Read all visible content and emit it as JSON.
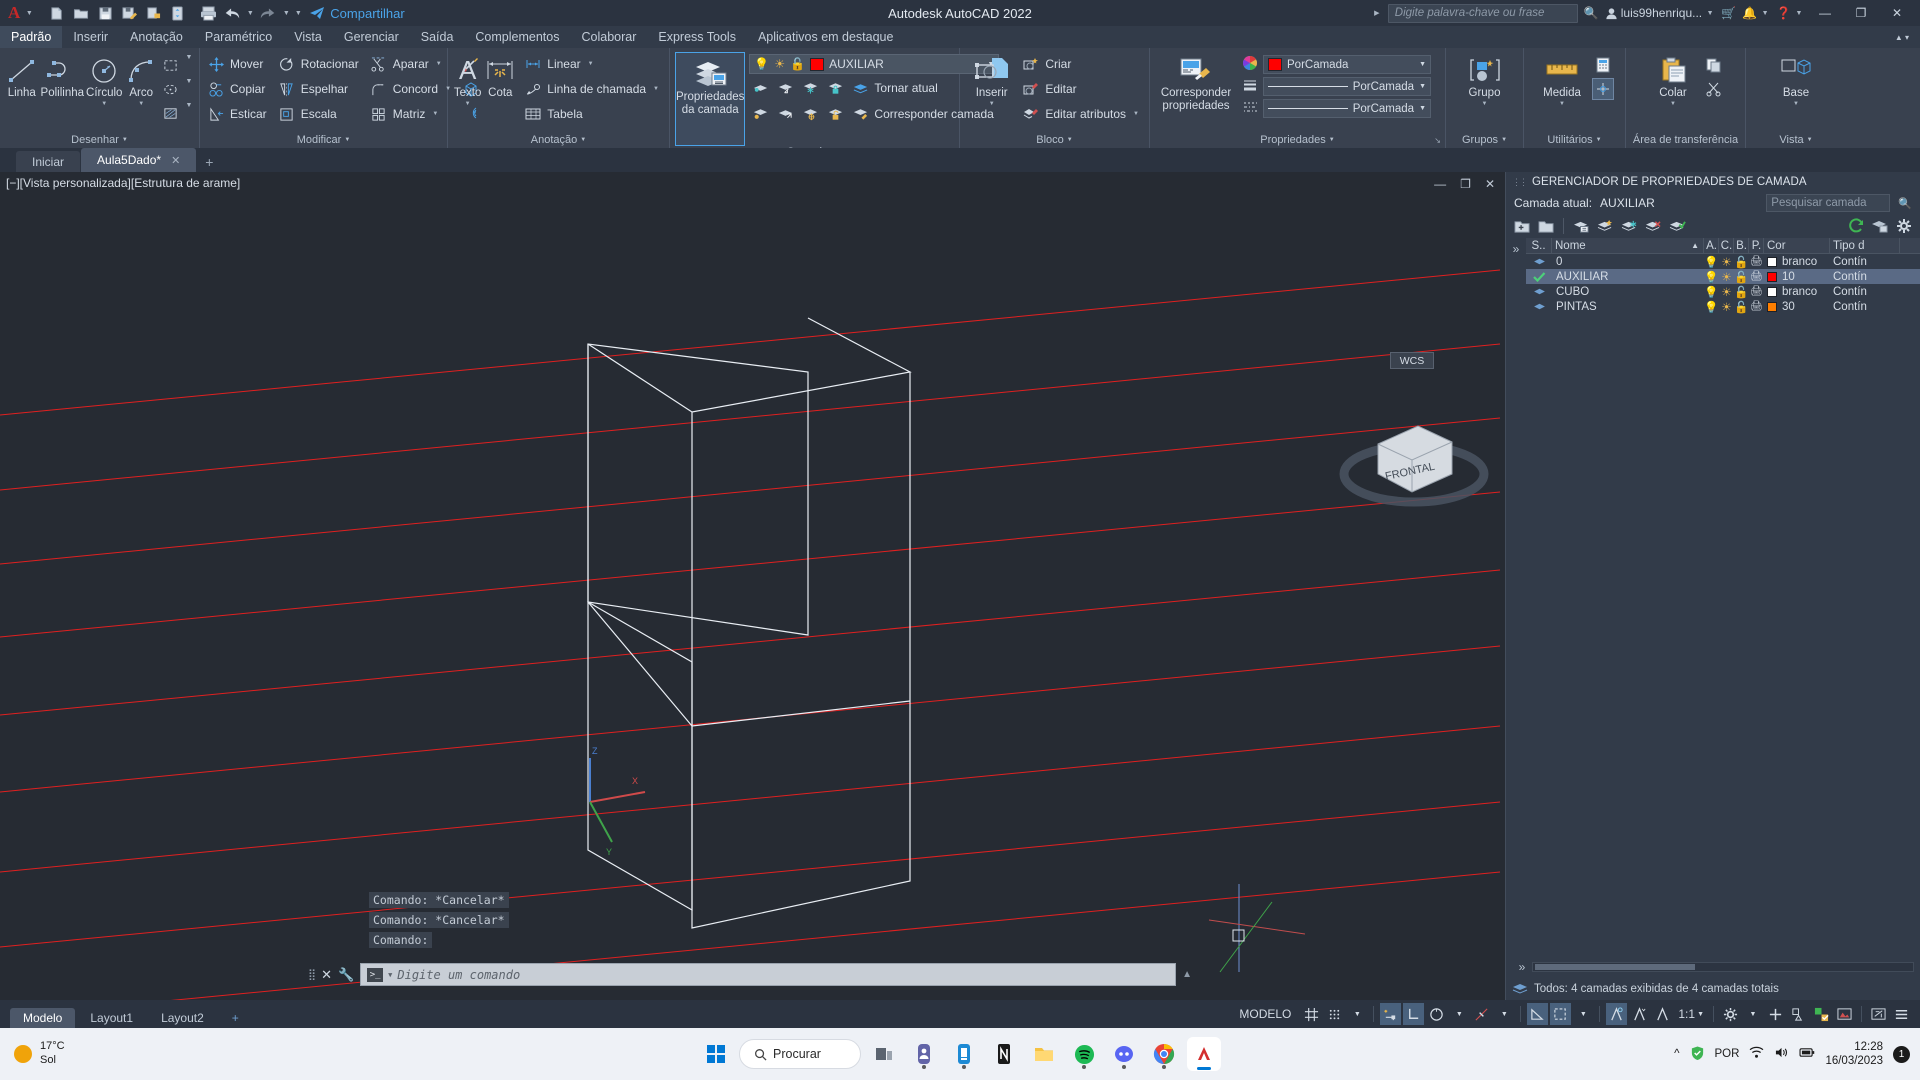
{
  "window": {
    "title": "Autodesk AutoCAD 2022",
    "share_label": "Compartilhar",
    "search_placeholder": "Digite palavra-chave ou frase",
    "user_name": "luis99henriqu...",
    "minimize": "—",
    "maximize": "❐",
    "close": "✕"
  },
  "quick_access": [
    {
      "name": "new-file-icon",
      "glyph": "🗋"
    },
    {
      "name": "open-file-icon",
      "glyph": "📁"
    },
    {
      "name": "save-icon",
      "glyph": "💾"
    },
    {
      "name": "save-as-icon",
      "glyph": "💾"
    },
    {
      "name": "export-icon",
      "glyph": "⬜"
    },
    {
      "name": "cloud-sync-icon",
      "glyph": "↻"
    },
    {
      "name": "plot-icon",
      "glyph": "🖨"
    },
    {
      "name": "undo-icon",
      "glyph": "←"
    },
    {
      "name": "redo-icon",
      "glyph": "→"
    }
  ],
  "ribbon_tabs": [
    {
      "label": "Padrão",
      "active": true
    },
    {
      "label": "Inserir",
      "active": false
    },
    {
      "label": "Anotação",
      "active": false
    },
    {
      "label": "Paramétrico",
      "active": false
    },
    {
      "label": "Vista",
      "active": false
    },
    {
      "label": "Gerenciar",
      "active": false
    },
    {
      "label": "Saída",
      "active": false
    },
    {
      "label": "Complementos",
      "active": false
    },
    {
      "label": "Colaborar",
      "active": false
    },
    {
      "label": "Express Tools",
      "active": false
    },
    {
      "label": "Aplicativos em destaque",
      "active": false
    }
  ],
  "ribbon": {
    "desenhar": {
      "title": "Desenhar",
      "big": [
        {
          "label": "Linha"
        },
        {
          "label": "Polilinha"
        },
        {
          "label": "Círculo",
          "dropdown": true
        },
        {
          "label": "Arco",
          "dropdown": true
        }
      ],
      "flyouts": [
        "rectangle-icon",
        "polygon-icon",
        "hatch-icon"
      ]
    },
    "modificar": {
      "title": "Modificar",
      "col1": [
        {
          "label": "Mover",
          "icon": "move-icon"
        },
        {
          "label": "Copiar",
          "icon": "copy-icon"
        },
        {
          "label": "Esticar",
          "icon": "stretch-icon"
        }
      ],
      "col2": [
        {
          "label": "Rotacionar",
          "icon": "rotate-icon"
        },
        {
          "label": "Espelhar",
          "icon": "mirror-icon"
        },
        {
          "label": "Escala",
          "icon": "scale-icon"
        }
      ],
      "col3": [
        {
          "label": "Aparar",
          "icon": "trim-icon",
          "dropdown": true
        },
        {
          "label": "Concord",
          "icon": "fillet-icon",
          "dropdown": true
        },
        {
          "label": "Matriz",
          "icon": "array-icon",
          "dropdown": true
        }
      ],
      "col4": [
        "explode-icon",
        "solid-icon",
        "offset-icon"
      ]
    },
    "anotacao": {
      "title": "Anotação",
      "big": [
        {
          "label": "Texto",
          "dropdown": true
        },
        {
          "label": "Cota"
        }
      ],
      "small": [
        {
          "label": "Linear",
          "icon": "linear-dimension-icon",
          "dropdown": true
        },
        {
          "label": "Linha de chamada",
          "icon": "leader-icon",
          "dropdown": true
        },
        {
          "label": "Tabela",
          "icon": "table-icon"
        }
      ]
    },
    "camadas": {
      "title": "Camadas",
      "big": {
        "line1": "Propriedades",
        "line2": "da camada"
      },
      "current_layer": "AUXILIAR",
      "current_layer_color": "#ff0000",
      "actions": [
        {
          "label": "Tornar atual",
          "icon": "make-current-icon"
        },
        {
          "label": "Corresponder camada",
          "icon": "match-layer-icon"
        }
      ]
    },
    "bloco": {
      "title": "Bloco",
      "big": {
        "label": "Inserir",
        "dropdown": true
      },
      "small": [
        {
          "label": "Criar",
          "icon": "create-block-icon"
        },
        {
          "label": "Editar",
          "icon": "edit-block-icon"
        },
        {
          "label": "Editar atributos",
          "icon": "edit-attributes-icon",
          "dropdown": true
        }
      ]
    },
    "propriedades": {
      "title": "Propriedades",
      "big": {
        "line1": "Corresponder",
        "line2": "propriedades"
      },
      "rows": [
        {
          "label": "PorCamada",
          "kind": "color",
          "swatch": "#ff0000",
          "icon": "color-wheel-icon"
        },
        {
          "label": "PorCamada",
          "kind": "lineweight",
          "icon": "lineweight-icon"
        },
        {
          "label": "PorCamada",
          "kind": "linetype",
          "icon": "linetype-icon"
        }
      ]
    },
    "grupos": {
      "title": "Grupos",
      "label": "Grupo"
    },
    "utilitarios": {
      "title": "Utilitários",
      "label": "Medida"
    },
    "area_transferencia": {
      "title": "Área de transferência",
      "label": "Colar"
    },
    "vista": {
      "title": "Vista",
      "label": "Base"
    }
  },
  "document_tabs": [
    {
      "label": "Iniciar",
      "active": false,
      "closable": false
    },
    {
      "label": "Aula5Dado*",
      "active": true,
      "closable": true
    }
  ],
  "document_tab_add": "+",
  "viewport": {
    "label": "[−][Vista personalizada][Estrutura de arame]",
    "wcs_badge": "WCS",
    "viewcube_face": "FRONTAL",
    "axes": {
      "x": "X",
      "y": "Y",
      "z": "Z"
    }
  },
  "command_history": [
    "Comando: *Cancelar*",
    "Comando: *Cancelar*",
    "Comando:"
  ],
  "command_input": {
    "placeholder": "Digite um comando",
    "close_icon": "✕",
    "customize_icon": "🔧"
  },
  "layer_manager": {
    "title": "GERENCIADOR DE PROPRIEDADES DE CAMADA",
    "current_layer_label": "Camada atual:",
    "current_layer": "AUXILIAR",
    "search_placeholder": "Pesquisar camada",
    "toolbar_icons": [
      "new-layer-icon",
      "new-layer-vp-frozen-icon",
      "delete-layer-icon",
      "set-current-icon",
      "layer-states-icon",
      "layer-freeze-icon",
      "layer-off-icon",
      "layer-check-icon"
    ],
    "refresh_icon": "refresh-icon",
    "settings_icon": "gear-icon",
    "columns": [
      "S..",
      "Nome",
      "A.",
      "C.",
      "B.",
      "P.",
      "Cor",
      "Tipo d"
    ],
    "rows": [
      {
        "status": "layer-icon",
        "name": "0",
        "color_name": "branco",
        "color": "#ffffff",
        "linetype": "Contín",
        "selected": false
      },
      {
        "status": "current-layer-check",
        "name": "AUXILIAR",
        "color_name": "10",
        "color": "#ff0000",
        "linetype": "Contín",
        "selected": true
      },
      {
        "status": "layer-icon",
        "name": "CUBO",
        "color_name": "branco",
        "color": "#ffffff",
        "linetype": "Contín",
        "selected": false
      },
      {
        "status": "layer-icon",
        "name": "PINTAS",
        "color_name": "30",
        "color": "#ff7f00",
        "linetype": "Contín",
        "selected": false
      }
    ],
    "status_text": "Todos: 4 camadas exibidas de 4 camadas totais"
  },
  "layout_tabs": [
    {
      "label": "Modelo",
      "active": true
    },
    {
      "label": "Layout1",
      "active": false
    },
    {
      "label": "Layout2",
      "active": false
    }
  ],
  "layout_tab_add": "+",
  "status_bar": {
    "space_label": "MODELO",
    "scale": "1:1",
    "items": [
      {
        "name": "grid-display-toggle",
        "glyph": "⌗",
        "on": false
      },
      {
        "name": "snap-mode-toggle",
        "glyph": "∷",
        "on": false,
        "dropdown": true
      },
      {
        "name": "infer-constraints-toggle",
        "glyph": "⊥",
        "on": true
      },
      {
        "name": "dynamic-ucs-toggle",
        "glyph": "└",
        "on": true
      },
      {
        "name": "object-snap-toggle",
        "glyph": "⧉",
        "on": false,
        "dropdown": true
      },
      {
        "name": "object-snap-tracking-toggle",
        "glyph": "∠",
        "on": false,
        "dropdown": true
      },
      {
        "name": "ortho-mode-toggle",
        "glyph": "∠",
        "on": true
      },
      {
        "name": "polar-tracking-toggle",
        "glyph": "◱",
        "on": true,
        "dropdown": true
      },
      {
        "name": "annotation-visibility-toggle",
        "glyph": "Å",
        "on": true
      },
      {
        "name": "autoscale-toggle",
        "glyph": "Å",
        "on": false
      },
      {
        "name": "annotation-scale-icon",
        "glyph": "Å",
        "on": false
      },
      {
        "name": "workspace-switching-icon",
        "glyph": "⚙",
        "on": false,
        "dropdown": true
      },
      {
        "name": "hardware-acceleration-icon",
        "glyph": "＋",
        "on": false
      },
      {
        "name": "isolate-objects-icon",
        "glyph": "□",
        "on": false
      },
      {
        "name": "customization-icon",
        "glyph": "☰",
        "on": false
      },
      {
        "name": "fullscreen-icon",
        "glyph": "⤡",
        "on": false
      }
    ]
  },
  "taskbar": {
    "weather": {
      "temp": "17°C",
      "condition": "Sol"
    },
    "search_label": "Procurar",
    "apps": [
      {
        "name": "start-button",
        "glyph": "⊞"
      },
      {
        "name": "taskview-icon",
        "glyph": "❑"
      },
      {
        "name": "teams-icon",
        "glyph": "💬"
      },
      {
        "name": "store-icon",
        "glyph": "🛒"
      },
      {
        "name": "notion-icon",
        "glyph": "N"
      },
      {
        "name": "explorer-icon",
        "glyph": "📁"
      },
      {
        "name": "spotify-icon",
        "glyph": "♫"
      },
      {
        "name": "discord-icon",
        "glyph": "🎮"
      },
      {
        "name": "chrome-icon",
        "glyph": "●"
      },
      {
        "name": "autocad-icon",
        "glyph": "A"
      }
    ],
    "tray": {
      "language": "POR",
      "time": "12:28",
      "date": "16/03/2023",
      "notification_count": "1"
    }
  }
}
